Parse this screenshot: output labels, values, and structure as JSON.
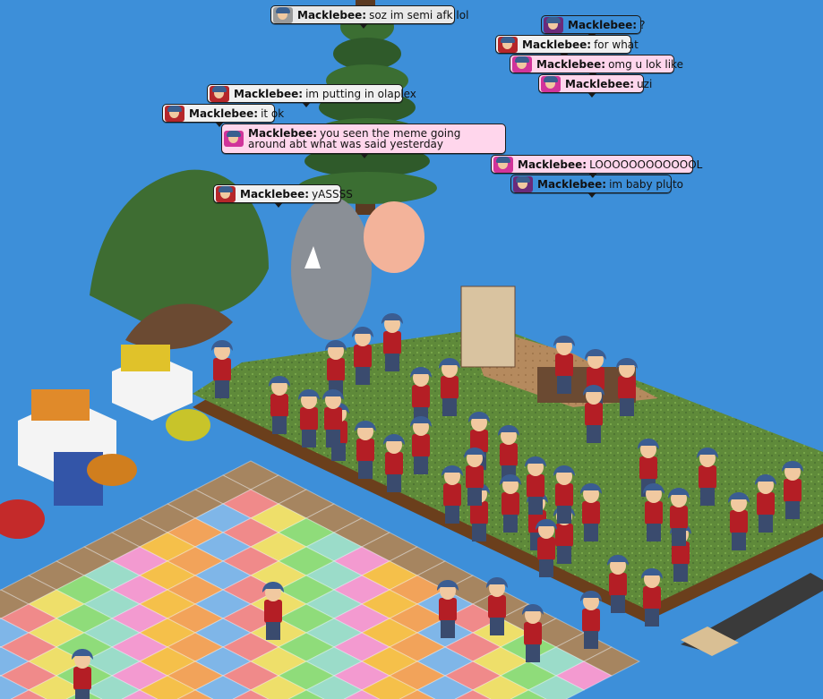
{
  "room": {
    "background_color": "#3d8fd9",
    "floor_colors": [
      "#f08a8a",
      "#f5c04a",
      "#8fdc7a",
      "#7fb6e8",
      "#f39ad0",
      "#eedf6a",
      "#f2a35a",
      "#9bdcc9"
    ],
    "rug_green": "#5f8a3a",
    "avatar_shirt": "#b41e25",
    "avatar_hair": "#3b5d92",
    "avatar_pants": "#3a4b6e"
  },
  "chat": [
    {
      "user": "Macklebee:",
      "text": "soz im semi afk lol",
      "style": "grey"
    },
    {
      "user": "Macklebee:",
      "text": "?",
      "style": "purple"
    },
    {
      "user": "Macklebee:",
      "text": "for what",
      "style": "red"
    },
    {
      "user": "Macklebee:",
      "text": "omg u lok like",
      "style": "pink"
    },
    {
      "user": "Macklebee:",
      "text": "uzi",
      "style": "pink"
    },
    {
      "user": "Macklebee:",
      "text": "im putting in olaplex",
      "style": "red"
    },
    {
      "user": "Macklebee:",
      "text": "it ok",
      "style": "red"
    },
    {
      "user": "Macklebee:",
      "text": "you seen the meme going around abt what was said yesterday",
      "style": "pink"
    },
    {
      "user": "Macklebee:",
      "text": "LOOOOOOOOOOOOL",
      "style": "pink"
    },
    {
      "user": "Macklebee:",
      "text": "im baby pluto",
      "style": "purple"
    },
    {
      "user": "Macklebee:",
      "text": "yASSSS",
      "style": "red"
    }
  ]
}
